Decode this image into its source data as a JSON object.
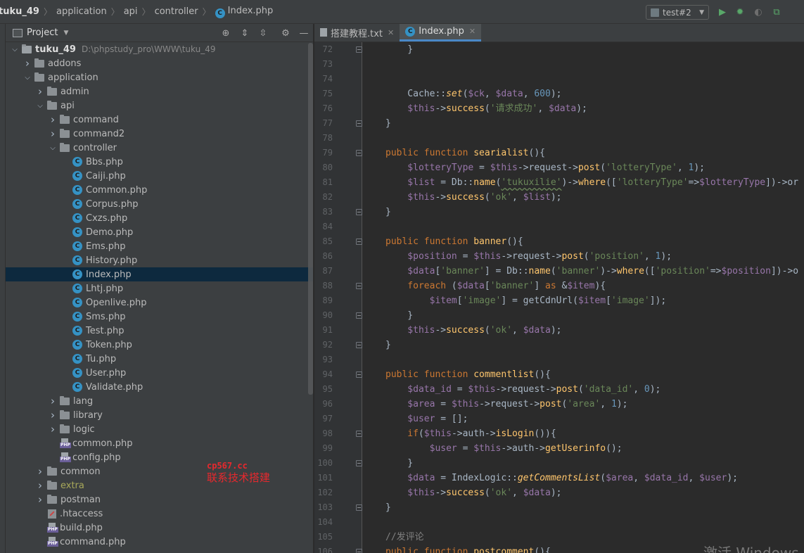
{
  "breadcrumbs": [
    "tuku_49",
    "application",
    "api",
    "controller",
    "Index.php"
  ],
  "run_config": "test#2",
  "project_panel": {
    "title": "Project",
    "tree": [
      {
        "indent": 0,
        "arrow": "open",
        "type": "root",
        "label": "tuku_49",
        "path": "D:\\phpstudy_pro\\WWW\\tuku_49"
      },
      {
        "indent": 1,
        "arrow": "closed",
        "type": "folder",
        "label": "addons"
      },
      {
        "indent": 1,
        "arrow": "open",
        "type": "folder",
        "label": "application"
      },
      {
        "indent": 2,
        "arrow": "closed",
        "type": "folder",
        "label": "admin"
      },
      {
        "indent": 2,
        "arrow": "open",
        "type": "folder",
        "label": "api"
      },
      {
        "indent": 3,
        "arrow": "closed",
        "type": "folder",
        "label": "command"
      },
      {
        "indent": 3,
        "arrow": "closed",
        "type": "folder",
        "label": "command2"
      },
      {
        "indent": 3,
        "arrow": "open",
        "type": "folder",
        "label": "controller"
      },
      {
        "indent": 4,
        "arrow": "none",
        "type": "class",
        "label": "Bbs.php"
      },
      {
        "indent": 4,
        "arrow": "none",
        "type": "class",
        "label": "Caiji.php"
      },
      {
        "indent": 4,
        "arrow": "none",
        "type": "class",
        "label": "Common.php"
      },
      {
        "indent": 4,
        "arrow": "none",
        "type": "class",
        "label": "Corpus.php"
      },
      {
        "indent": 4,
        "arrow": "none",
        "type": "class",
        "label": "Cxzs.php"
      },
      {
        "indent": 4,
        "arrow": "none",
        "type": "class",
        "label": "Demo.php"
      },
      {
        "indent": 4,
        "arrow": "none",
        "type": "class",
        "label": "Ems.php"
      },
      {
        "indent": 4,
        "arrow": "none",
        "type": "class",
        "label": "History.php"
      },
      {
        "indent": 4,
        "arrow": "none",
        "type": "class",
        "label": "Index.php",
        "selected": true
      },
      {
        "indent": 4,
        "arrow": "none",
        "type": "class",
        "label": "Lhtj.php"
      },
      {
        "indent": 4,
        "arrow": "none",
        "type": "class",
        "label": "Openlive.php"
      },
      {
        "indent": 4,
        "arrow": "none",
        "type": "class",
        "label": "Sms.php"
      },
      {
        "indent": 4,
        "arrow": "none",
        "type": "class",
        "label": "Test.php"
      },
      {
        "indent": 4,
        "arrow": "none",
        "type": "class",
        "label": "Token.php"
      },
      {
        "indent": 4,
        "arrow": "none",
        "type": "class",
        "label": "Tu.php"
      },
      {
        "indent": 4,
        "arrow": "none",
        "type": "class",
        "label": "User.php"
      },
      {
        "indent": 4,
        "arrow": "none",
        "type": "class",
        "label": "Validate.php"
      },
      {
        "indent": 3,
        "arrow": "closed",
        "type": "folder",
        "label": "lang"
      },
      {
        "indent": 3,
        "arrow": "closed",
        "type": "folder",
        "label": "library"
      },
      {
        "indent": 3,
        "arrow": "closed",
        "type": "folder",
        "label": "logic"
      },
      {
        "indent": 3,
        "arrow": "none",
        "type": "php",
        "label": "common.php"
      },
      {
        "indent": 3,
        "arrow": "none",
        "type": "php",
        "label": "config.php"
      },
      {
        "indent": 2,
        "arrow": "closed",
        "type": "folder",
        "label": "common"
      },
      {
        "indent": 2,
        "arrow": "closed",
        "type": "folder",
        "label": "extra",
        "excluded": true
      },
      {
        "indent": 2,
        "arrow": "closed",
        "type": "folder",
        "label": "postman"
      },
      {
        "indent": 2,
        "arrow": "none",
        "type": "gitfile",
        "label": ".htaccess"
      },
      {
        "indent": 2,
        "arrow": "none",
        "type": "php",
        "label": "build.php"
      },
      {
        "indent": 2,
        "arrow": "none",
        "type": "php",
        "label": "command.php"
      }
    ]
  },
  "watermark": {
    "line1": "cp567.cc",
    "line2": "联系技术搭建"
  },
  "editor": {
    "tabs": [
      {
        "label": "搭建教程.txt",
        "icon": "text",
        "active": false
      },
      {
        "label": "Index.php",
        "icon": "class",
        "active": true
      }
    ],
    "lines": [
      {
        "n": "72",
        "fold": true,
        "tokens": [
          [
            "plain",
            "    }"
          ]
        ]
      },
      {
        "n": "73",
        "tokens": []
      },
      {
        "n": "74",
        "tokens": []
      },
      {
        "n": "75",
        "tokens": [
          [
            "plain",
            "    Cache::"
          ],
          [
            "fni",
            "set"
          ],
          [
            "plain",
            "("
          ],
          [
            "var",
            "$ck"
          ],
          [
            "plain",
            ", "
          ],
          [
            "var",
            "$data"
          ],
          [
            "plain",
            ", "
          ],
          [
            "num",
            "600"
          ],
          [
            "plain",
            ");"
          ]
        ]
      },
      {
        "n": "76",
        "tokens": [
          [
            "var",
            "    $this"
          ],
          [
            "plain",
            "->"
          ],
          [
            "fn",
            "success"
          ],
          [
            "plain",
            "("
          ],
          [
            "str",
            "'请求成功'"
          ],
          [
            "plain",
            ", "
          ],
          [
            "var",
            "$data"
          ],
          [
            "plain",
            ");"
          ]
        ]
      },
      {
        "n": "77",
        "fold": true,
        "tokens": [
          [
            "plain",
            "}"
          ]
        ]
      },
      {
        "n": "78",
        "tokens": []
      },
      {
        "n": "79",
        "fold": true,
        "tokens": [
          [
            "kw",
            "public function "
          ],
          [
            "fn",
            "searialist"
          ],
          [
            "plain",
            "(){"
          ]
        ]
      },
      {
        "n": "80",
        "tokens": [
          [
            "var",
            "    $lotteryType"
          ],
          [
            "plain",
            " = "
          ],
          [
            "var",
            "$this"
          ],
          [
            "plain",
            "->request->"
          ],
          [
            "fn",
            "post"
          ],
          [
            "plain",
            "("
          ],
          [
            "str",
            "'lotteryType'"
          ],
          [
            "plain",
            ", "
          ],
          [
            "num",
            "1"
          ],
          [
            "plain",
            ");"
          ]
        ]
      },
      {
        "n": "81",
        "tokens": [
          [
            "var",
            "    $list"
          ],
          [
            "plain",
            " = Db::"
          ],
          [
            "fn",
            "name"
          ],
          [
            "plain",
            "("
          ],
          [
            "str",
            "'tukuxilie'"
          ],
          [
            "plain",
            ")->"
          ],
          [
            "fn",
            "where"
          ],
          [
            "plain",
            "(["
          ],
          [
            "str",
            "'lotteryType'"
          ],
          [
            "plain",
            "=>"
          ],
          [
            "var",
            "$lotteryType"
          ],
          [
            "plain",
            "])->or"
          ]
        ]
      },
      {
        "n": "82",
        "tokens": [
          [
            "var",
            "    $this"
          ],
          [
            "plain",
            "->"
          ],
          [
            "fn",
            "success"
          ],
          [
            "plain",
            "("
          ],
          [
            "str",
            "'ok'"
          ],
          [
            "plain",
            ", "
          ],
          [
            "var",
            "$list"
          ],
          [
            "plain",
            ");"
          ]
        ]
      },
      {
        "n": "83",
        "fold": true,
        "tokens": [
          [
            "plain",
            "}"
          ]
        ]
      },
      {
        "n": "84",
        "tokens": []
      },
      {
        "n": "85",
        "fold": true,
        "tokens": [
          [
            "kw",
            "public function "
          ],
          [
            "fn",
            "banner"
          ],
          [
            "plain",
            "(){"
          ]
        ]
      },
      {
        "n": "86",
        "tokens": [
          [
            "var",
            "    $position"
          ],
          [
            "plain",
            " = "
          ],
          [
            "var",
            "$this"
          ],
          [
            "plain",
            "->request->"
          ],
          [
            "fn",
            "post"
          ],
          [
            "plain",
            "("
          ],
          [
            "str",
            "'position'"
          ],
          [
            "plain",
            ", "
          ],
          [
            "num",
            "1"
          ],
          [
            "plain",
            ");"
          ]
        ]
      },
      {
        "n": "87",
        "tokens": [
          [
            "var",
            "    $data"
          ],
          [
            "plain",
            "["
          ],
          [
            "str",
            "'banner'"
          ],
          [
            "plain",
            "] = Db::"
          ],
          [
            "fn",
            "name"
          ],
          [
            "plain",
            "("
          ],
          [
            "str",
            "'banner'"
          ],
          [
            "plain",
            ")->"
          ],
          [
            "fn",
            "where"
          ],
          [
            "plain",
            "(["
          ],
          [
            "str",
            "'position'"
          ],
          [
            "plain",
            "=>"
          ],
          [
            "var",
            "$position"
          ],
          [
            "plain",
            "])->o"
          ]
        ]
      },
      {
        "n": "88",
        "fold": true,
        "tokens": [
          [
            "kw",
            "    foreach "
          ],
          [
            "plain",
            "("
          ],
          [
            "var",
            "$data"
          ],
          [
            "plain",
            "["
          ],
          [
            "str",
            "'banner'"
          ],
          [
            "plain",
            "] "
          ],
          [
            "kw",
            "as "
          ],
          [
            "plain",
            "&"
          ],
          [
            "var",
            "$item"
          ],
          [
            "plain",
            "){"
          ]
        ]
      },
      {
        "n": "89",
        "tokens": [
          [
            "var",
            "        $item"
          ],
          [
            "plain",
            "["
          ],
          [
            "str",
            "'image'"
          ],
          [
            "plain",
            "] = getCdnUrl("
          ],
          [
            "var",
            "$item"
          ],
          [
            "plain",
            "["
          ],
          [
            "str",
            "'image'"
          ],
          [
            "plain",
            "]);"
          ]
        ]
      },
      {
        "n": "90",
        "fold": true,
        "tokens": [
          [
            "plain",
            "    }"
          ]
        ]
      },
      {
        "n": "91",
        "tokens": [
          [
            "var",
            "    $this"
          ],
          [
            "plain",
            "->"
          ],
          [
            "fn",
            "success"
          ],
          [
            "plain",
            "("
          ],
          [
            "str",
            "'ok'"
          ],
          [
            "plain",
            ", "
          ],
          [
            "var",
            "$data"
          ],
          [
            "plain",
            ");"
          ]
        ]
      },
      {
        "n": "92",
        "fold": true,
        "tokens": [
          [
            "plain",
            "}"
          ]
        ]
      },
      {
        "n": "93",
        "tokens": []
      },
      {
        "n": "94",
        "fold": true,
        "tokens": [
          [
            "kw",
            "public function "
          ],
          [
            "fn",
            "commentlist"
          ],
          [
            "plain",
            "(){"
          ]
        ]
      },
      {
        "n": "95",
        "tokens": [
          [
            "var",
            "    $data_id"
          ],
          [
            "plain",
            " = "
          ],
          [
            "var",
            "$this"
          ],
          [
            "plain",
            "->request->"
          ],
          [
            "fn",
            "post"
          ],
          [
            "plain",
            "("
          ],
          [
            "str",
            "'data_id'"
          ],
          [
            "plain",
            ", "
          ],
          [
            "num",
            "0"
          ],
          [
            "plain",
            ");"
          ]
        ]
      },
      {
        "n": "96",
        "tokens": [
          [
            "var",
            "    $area"
          ],
          [
            "plain",
            " = "
          ],
          [
            "var",
            "$this"
          ],
          [
            "plain",
            "->request->"
          ],
          [
            "fn",
            "post"
          ],
          [
            "plain",
            "("
          ],
          [
            "str",
            "'area'"
          ],
          [
            "plain",
            ", "
          ],
          [
            "num",
            "1"
          ],
          [
            "plain",
            ");"
          ]
        ]
      },
      {
        "n": "97",
        "tokens": [
          [
            "var",
            "    $user"
          ],
          [
            "plain",
            " = [];"
          ]
        ]
      },
      {
        "n": "98",
        "fold": true,
        "tokens": [
          [
            "kw",
            "    if"
          ],
          [
            "plain",
            "("
          ],
          [
            "var",
            "$this"
          ],
          [
            "plain",
            "->auth->"
          ],
          [
            "fn",
            "isLogin"
          ],
          [
            "plain",
            "()){"
          ]
        ]
      },
      {
        "n": "99",
        "tokens": [
          [
            "var",
            "        $user"
          ],
          [
            "plain",
            " = "
          ],
          [
            "var",
            "$this"
          ],
          [
            "plain",
            "->auth->"
          ],
          [
            "fn",
            "getUserinfo"
          ],
          [
            "plain",
            "();"
          ]
        ]
      },
      {
        "n": "100",
        "fold": true,
        "tokens": [
          [
            "plain",
            "    }"
          ]
        ]
      },
      {
        "n": "101",
        "tokens": [
          [
            "var",
            "    $data"
          ],
          [
            "plain",
            " = IndexLogic::"
          ],
          [
            "fni",
            "getCommentsList"
          ],
          [
            "plain",
            "("
          ],
          [
            "var",
            "$area"
          ],
          [
            "plain",
            ", "
          ],
          [
            "var",
            "$data_id"
          ],
          [
            "plain",
            ", "
          ],
          [
            "var",
            "$user"
          ],
          [
            "plain",
            ");"
          ]
        ]
      },
      {
        "n": "102",
        "tokens": [
          [
            "var",
            "    $this"
          ],
          [
            "plain",
            "->"
          ],
          [
            "fn",
            "success"
          ],
          [
            "plain",
            "("
          ],
          [
            "str",
            "'ok'"
          ],
          [
            "plain",
            ", "
          ],
          [
            "var",
            "$data"
          ],
          [
            "plain",
            ");"
          ]
        ]
      },
      {
        "n": "103",
        "fold": true,
        "tokens": [
          [
            "plain",
            "}"
          ]
        ]
      },
      {
        "n": "104",
        "tokens": []
      },
      {
        "n": "105",
        "tokens": [
          [
            "cmt",
            "//发评论"
          ]
        ]
      },
      {
        "n": "106",
        "fold": true,
        "tokens": [
          [
            "kw",
            "public function "
          ],
          [
            "fn",
            "postcomment"
          ],
          [
            "plain",
            "(){"
          ]
        ]
      }
    ]
  },
  "system_overlay": "激活 Windows"
}
